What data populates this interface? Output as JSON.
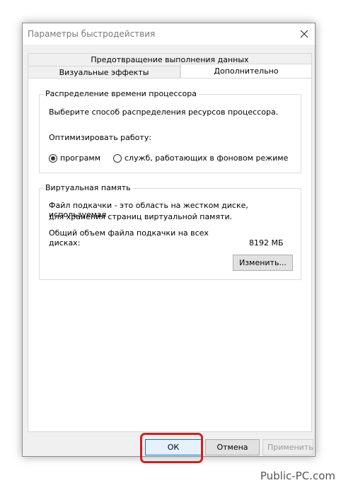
{
  "window": {
    "title": "Параметры быстродействия",
    "close_icon": "close-icon"
  },
  "tabs": {
    "data_execution_prevention": "Предотвращение выполнения данных",
    "visual_effects": "Визуальные эффекты",
    "advanced": "Дополнительно"
  },
  "processor_scheduling": {
    "group_title": "Распределение времени процессора",
    "description": "Выберите способ распределения ресурсов процессора.",
    "optimize_label": "Оптимизировать работу:",
    "options": [
      {
        "label": "программ",
        "selected": true
      },
      {
        "label": "служб, работающих в фоновом режиме",
        "selected": false
      }
    ]
  },
  "virtual_memory": {
    "group_title": "Виртуальная память",
    "description_line1": "Файл подкачки - это область на жестком диске, используемая",
    "description_line2": "для хранения страниц виртуальной памяти.",
    "total_label_line1": "Общий объем файла подкачки на всех",
    "total_label_line2": "дисках:",
    "total_value": "8192 МБ",
    "change_button": "Изменить..."
  },
  "buttons": {
    "ok": "ОК",
    "cancel": "Отмена",
    "apply": "Применить"
  },
  "colors": {
    "highlight": "#d21f1f",
    "dialog_bg": "#f0f0f0",
    "panel_bg": "#ffffff"
  },
  "watermark": "Public-PC.com"
}
